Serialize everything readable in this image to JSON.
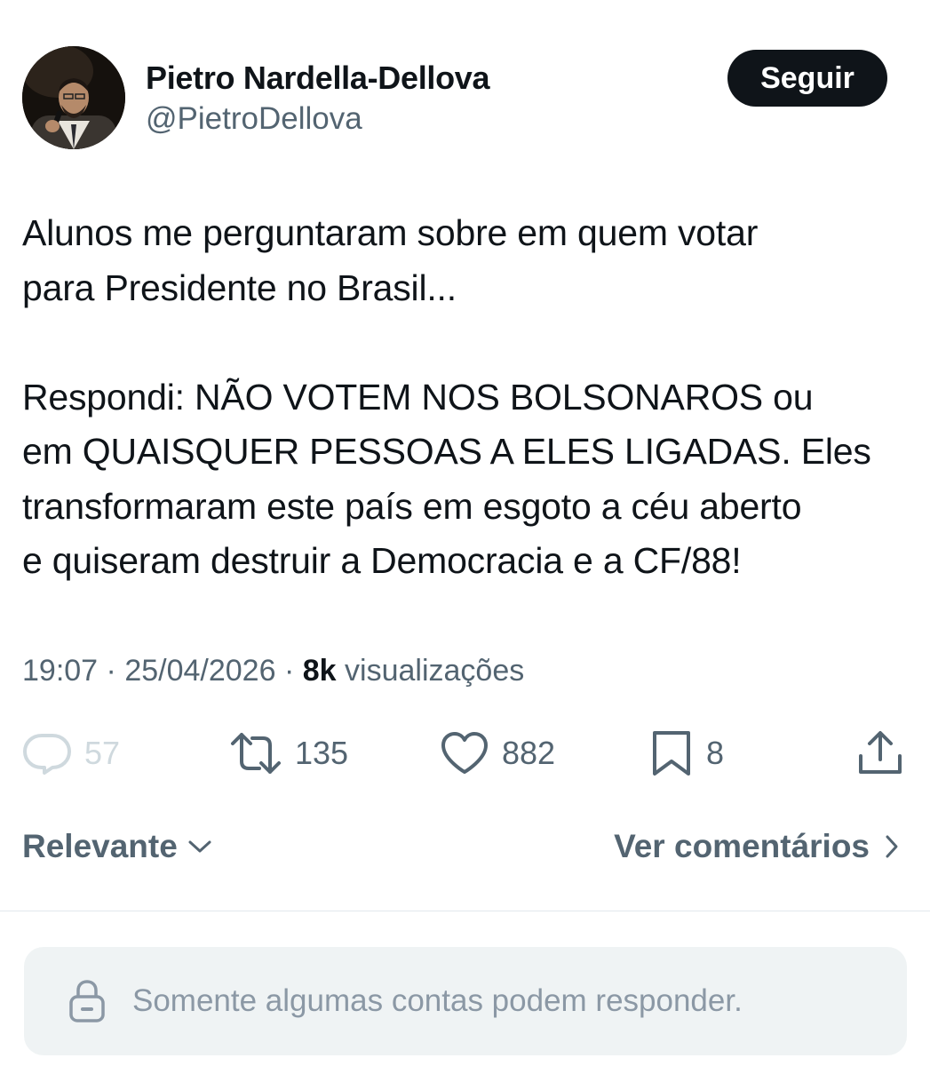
{
  "author": {
    "display_name": "Pietro Nardella-Dellova",
    "handle": "@PietroDellova",
    "avatar_icon": "profile-photo",
    "follow_label": "Seguir"
  },
  "tweet": {
    "text": "Alunos me perguntaram sobre em quem votar\npara Presidente no Brasil...\n\nRespondi: NÃO VOTEM NOS BOLSONAROS ou\nem QUAISQUER PESSOAS A ELES LIGADAS. Eles\ntransformaram este país em esgoto a céu aberto\ne quiseram destruir a Democracia e a CF/88!",
    "time": "19:07",
    "separator": "·",
    "date": "25/04/2026",
    "views_count": "8k",
    "views_label": "visualizações"
  },
  "actions": {
    "replies": {
      "icon": "reply-icon",
      "count": "57"
    },
    "retweets": {
      "icon": "retweet-icon",
      "count": "135"
    },
    "likes": {
      "icon": "heart-icon",
      "count": "882"
    },
    "bookmarks": {
      "icon": "bookmark-icon",
      "count": "8"
    },
    "share": {
      "icon": "share-icon"
    }
  },
  "replies_bar": {
    "sort_label": "Relevante",
    "view_comments_label": "Ver comentários"
  },
  "reply_restriction": {
    "icon": "lock-icon",
    "text": "Somente algumas contas podem responder."
  },
  "colors": {
    "text": "#0f1419",
    "secondary": "#536471",
    "disabled": "#cfd9de",
    "button_bg": "#0f1419",
    "reply_box_bg": "#eff3f4"
  }
}
